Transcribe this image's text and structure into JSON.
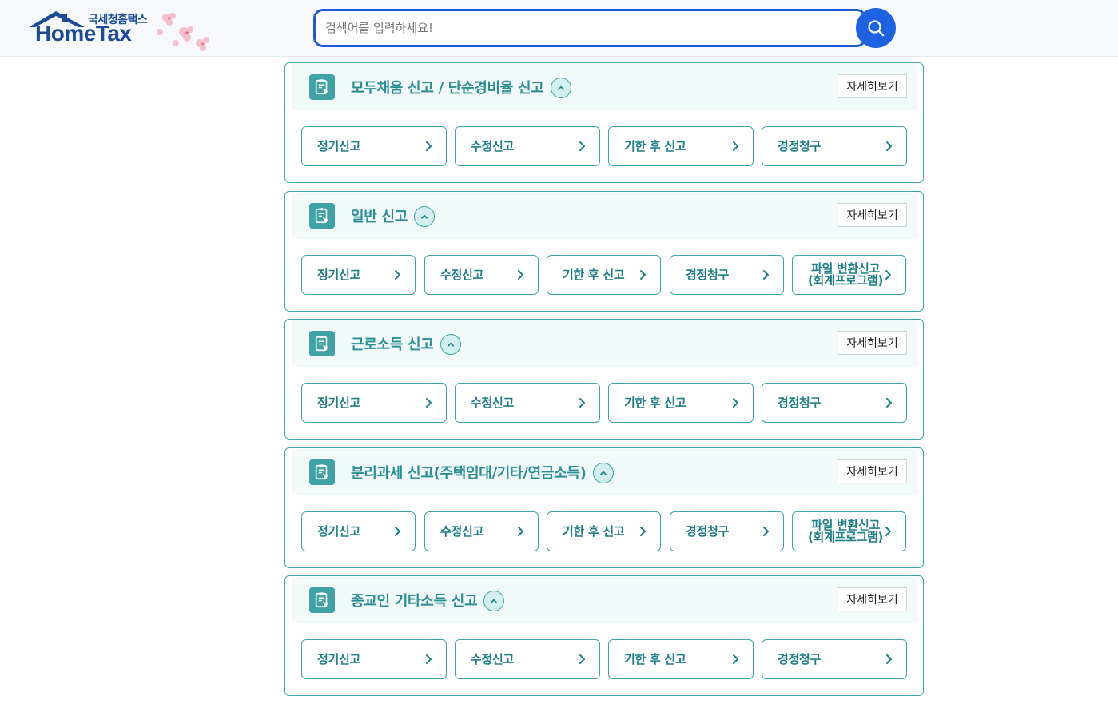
{
  "header": {
    "logo_small": "국세청홈택스",
    "logo_big": "HomeTax",
    "search_placeholder": "검색어를 입력하세요!"
  },
  "colors": {
    "accent": "#3ea6a8",
    "text_teal": "#1e7f86",
    "search_blue": "#1e62e3"
  },
  "sections": [
    {
      "title": "모두채움 신고 / 단순경비율 신고",
      "detail_label": "자세히보기",
      "buttons": [
        "정기신고",
        "수정신고",
        "기한 후 신고",
        "경정청구"
      ]
    },
    {
      "title": "일반 신고",
      "detail_label": "자세히보기",
      "buttons": [
        "정기신고",
        "수정신고",
        "기한 후 신고",
        "경정청구",
        "파일 변환신고\n(회계프로그램)"
      ]
    },
    {
      "title": "근로소득 신고",
      "detail_label": "자세히보기",
      "buttons": [
        "정기신고",
        "수정신고",
        "기한 후 신고",
        "경정청구"
      ]
    },
    {
      "title": "분리과세 신고(주택임대/기타/연금소득)",
      "detail_label": "자세히보기",
      "buttons": [
        "정기신고",
        "수정신고",
        "기한 후 신고",
        "경정청구",
        "파일 변환신고\n(회계프로그램)"
      ]
    },
    {
      "title": "종교인 기타소득 신고",
      "detail_label": "자세히보기",
      "buttons": [
        "정기신고",
        "수정신고",
        "기한 후 신고",
        "경정청구"
      ]
    }
  ]
}
